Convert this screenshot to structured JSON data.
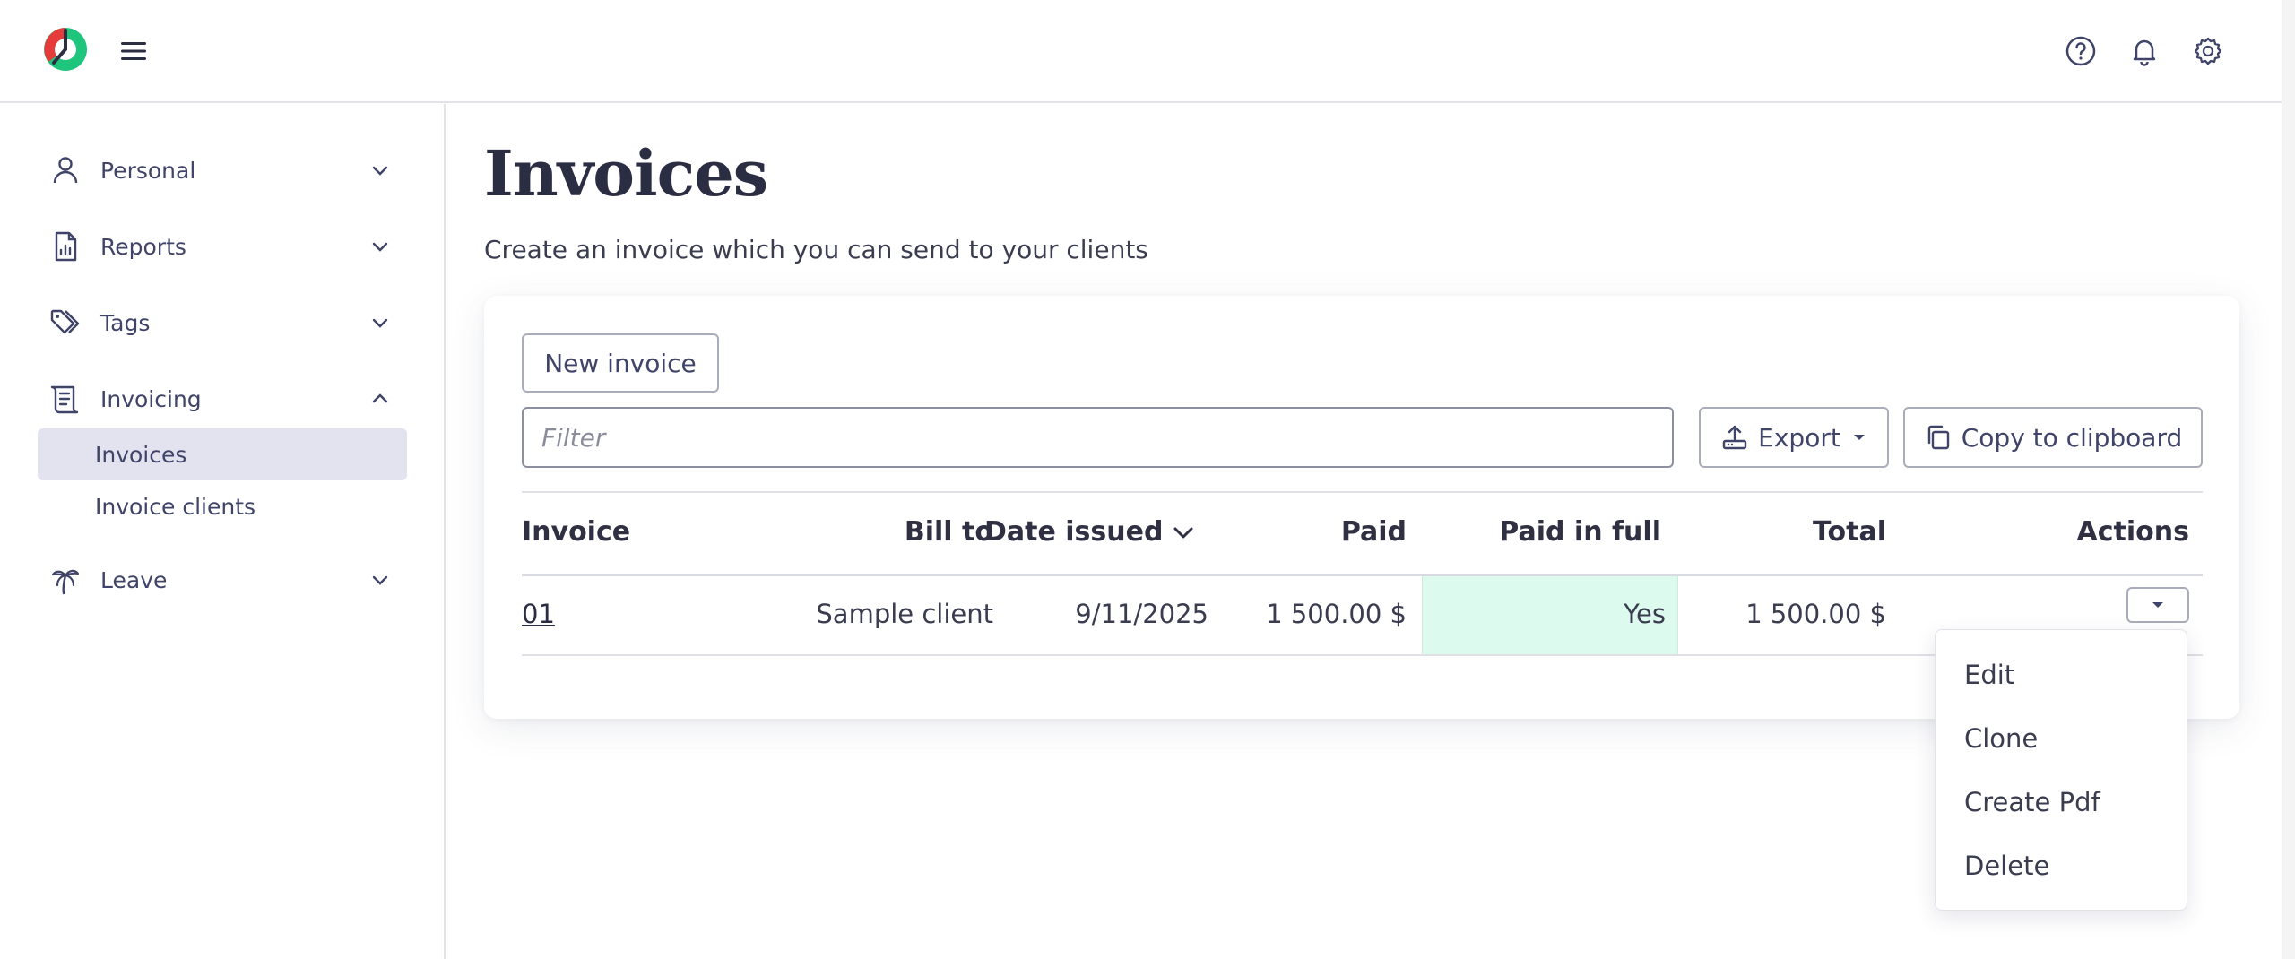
{
  "sidebar": {
    "items": [
      {
        "label": "Personal",
        "icon": "user-icon",
        "expanded": false
      },
      {
        "label": "Reports",
        "icon": "report-icon",
        "expanded": false
      },
      {
        "label": "Tags",
        "icon": "tags-icon",
        "expanded": false
      },
      {
        "label": "Invoicing",
        "icon": "invoicing-icon",
        "expanded": true
      },
      {
        "label": "Leave",
        "icon": "palm-tree-icon",
        "expanded": false
      }
    ],
    "invoicing_children": [
      {
        "label": "Invoices",
        "active": true
      },
      {
        "label": "Invoice clients",
        "active": false
      }
    ]
  },
  "main": {
    "title": "Invoices",
    "subtitle": "Create an invoice which you can send to your clients",
    "new_invoice_label": "New invoice",
    "filter_placeholder": "Filter",
    "export_label": "Export",
    "copy_label": "Copy to clipboard"
  },
  "table": {
    "columns": [
      "Invoice",
      "Bill to",
      "Date issued",
      "Paid",
      "Paid in full",
      "Total",
      "Actions"
    ],
    "sorted_column": "Date issued",
    "rows": [
      {
        "invoice": "01",
        "bill_to": "Sample client",
        "date_issued": "9/11/2025",
        "paid": "1 500.00 $",
        "paid_in_full": "Yes",
        "total": "1 500.00 $"
      }
    ]
  },
  "actions_menu": {
    "items": [
      "Edit",
      "Clone",
      "Create Pdf",
      "Delete"
    ]
  },
  "colors": {
    "accent_green": "#1fc47d",
    "accent_red": "#e53b3b",
    "paid_full_bg": "#dcfbee",
    "active_nav_bg": "#e2e3ef"
  }
}
